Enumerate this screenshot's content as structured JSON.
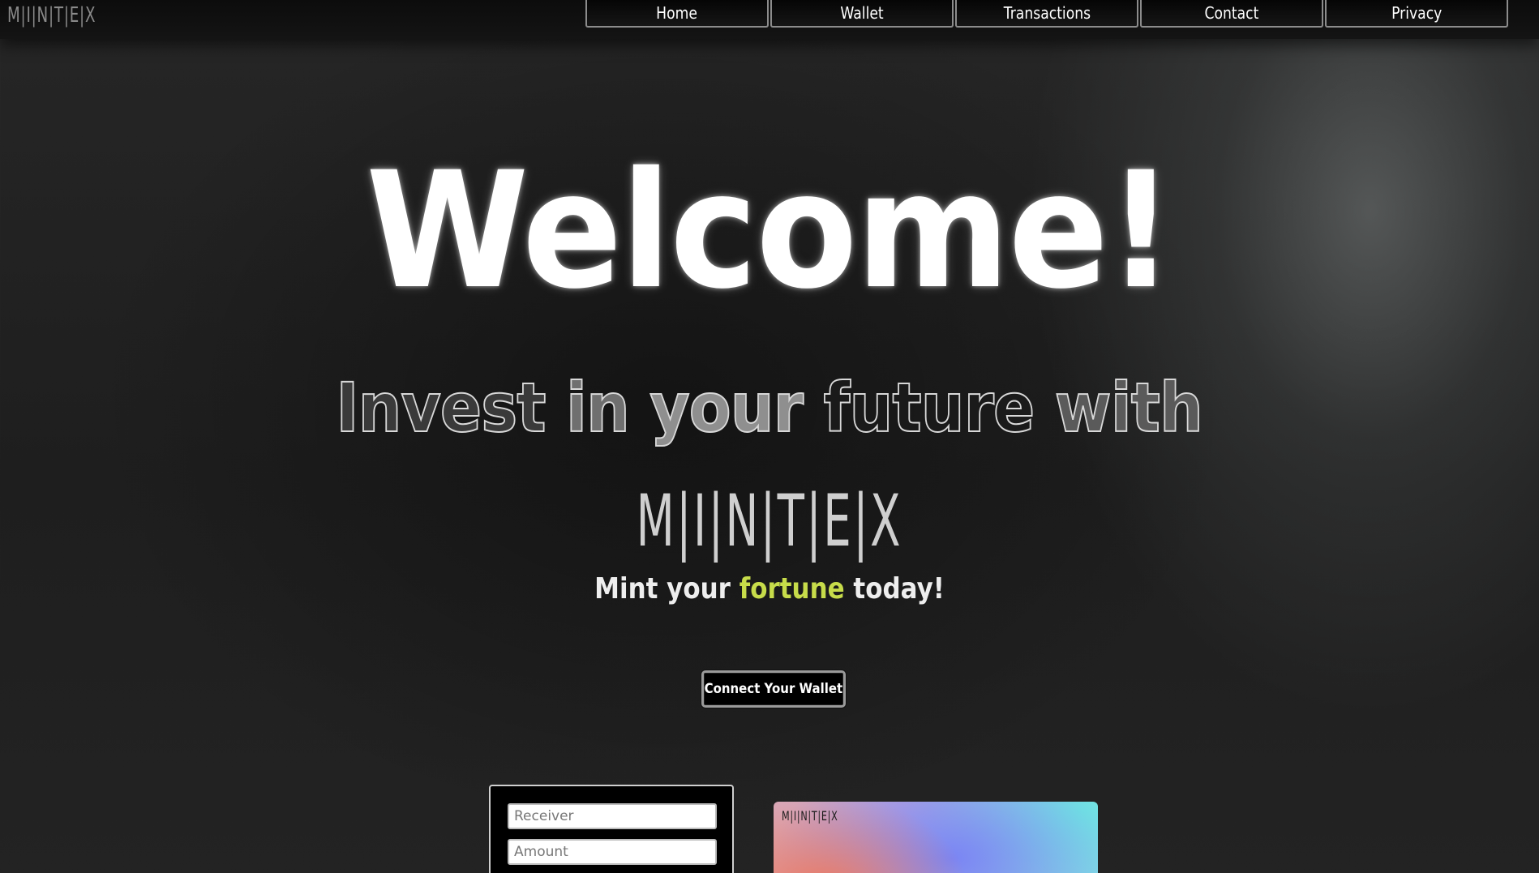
{
  "header": {
    "logo_text": "M|I|N|T|E|X",
    "nav": [
      {
        "label": "Home"
      },
      {
        "label": "Wallet"
      },
      {
        "label": "Transactions"
      },
      {
        "label": "Contact"
      },
      {
        "label": "Privacy"
      }
    ]
  },
  "hero": {
    "welcome": "Welcome!",
    "tagline": {
      "invest": "Invest",
      "in": "in",
      "your": "your",
      "future": "future",
      "with": "with"
    },
    "brand": "M|I|N|T|E|X",
    "subtitle": {
      "before": "Mint your",
      "accent": "fortune",
      "after": "today!"
    },
    "connect_button": "Connect Your Wallet"
  },
  "form": {
    "receiver_placeholder": "Receiver",
    "amount_placeholder": "Amount"
  },
  "card": {
    "logo_text": "M|I|N|T|E|X"
  },
  "colors": {
    "accent": "#c7dc4a",
    "background": "#1e1e1e"
  }
}
